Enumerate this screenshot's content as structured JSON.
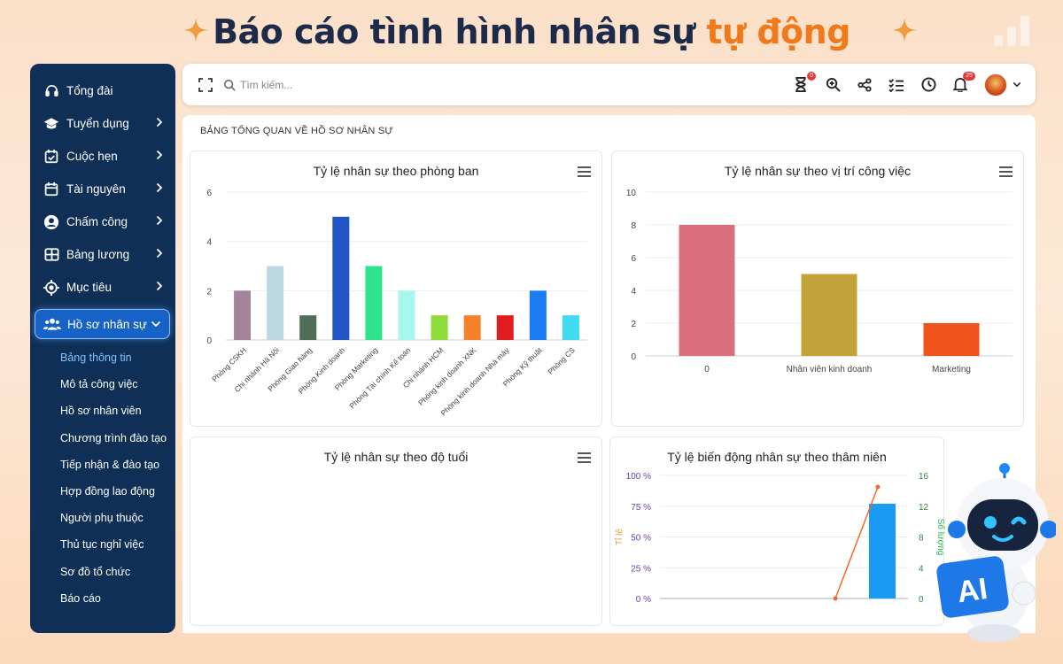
{
  "banner": {
    "title_main": "Báo cáo tình hình nhân sự ",
    "title_highlight": "tự động"
  },
  "sidebar": {
    "items": [
      {
        "label": "Tổng đài",
        "icon": "headset-icon",
        "chevron": false
      },
      {
        "label": "Tuyển dụng",
        "icon": "graduation-cap-icon",
        "chevron": true
      },
      {
        "label": "Cuộc hẹn",
        "icon": "calendar-check-icon",
        "chevron": true
      },
      {
        "label": "Tài nguyên",
        "icon": "calendar-icon",
        "chevron": true
      },
      {
        "label": "Chấm công",
        "icon": "user-circle-icon",
        "chevron": true
      },
      {
        "label": "Bảng lương",
        "icon": "table-icon",
        "chevron": true
      },
      {
        "label": "Mục tiêu",
        "icon": "target-icon",
        "chevron": true
      },
      {
        "label": "Hồ sơ nhân sự",
        "icon": "users-icon",
        "chevron": true,
        "active": true
      }
    ],
    "subitems": [
      "Bảng thông tin",
      "Mô tả công việc",
      "Hồ sơ nhân viên",
      "Chương trình đào tạo",
      "Tiếp nhận & đào tạo",
      "Hợp đồng lao động",
      "Người phụ thuộc",
      "Thủ tục nghỉ việc",
      "Sơ đồ tổ chức",
      "Báo cáo"
    ],
    "current_subitem": "Bảng thông tin"
  },
  "topbar": {
    "search_placeholder": "Tìm kiếm...",
    "timer_badge": "0",
    "notification_badge": "25"
  },
  "content": {
    "title": "BẢNG TỔNG QUAN VỀ HỒ SƠ NHÂN SỰ"
  },
  "chart_data": [
    {
      "type": "bar",
      "title": "Tỷ lệ nhân sự theo phòng ban",
      "categories": [
        "Phòng CSKH",
        "Chi nhánh Hà Nội",
        "Phòng Giao hàng",
        "Phòng Kinh doanh",
        "Phòng Marketing",
        "Phòng Tài chính Kế toán",
        "Chi nhánh HCM",
        "Phòng kinh doanh XNK",
        "Phòng kinh doanh Nhà máy",
        "Phòng Kỹ thuật",
        "Phòng CS"
      ],
      "values": [
        2,
        3,
        1,
        5,
        3,
        2,
        1,
        1,
        1,
        2,
        1
      ],
      "colors": [
        "#a3849b",
        "#bcd9e3",
        "#4e6e58",
        "#1f56c4",
        "#2fe38c",
        "#a8f7ee",
        "#8fdb3a",
        "#f5822a",
        "#e11d20",
        "#1b7bf2",
        "#40dbf0"
      ],
      "ylim": [
        0,
        6
      ],
      "yticks": [
        0,
        2,
        4,
        6
      ],
      "grid": true
    },
    {
      "type": "bar",
      "title": "Tỷ lệ nhân sự theo vị trí công việc",
      "categories": [
        "0",
        "Nhân viên kinh doanh",
        "Marketing"
      ],
      "values": [
        8,
        5,
        2
      ],
      "colors": [
        "#d96f7d",
        "#c4a23a",
        "#f0531a"
      ],
      "ylim": [
        0,
        10
      ],
      "yticks": [
        0,
        2,
        4,
        6,
        8,
        10
      ],
      "grid": true
    },
    {
      "type": "bar",
      "title": "Tỷ lệ nhân sự theo độ tuổi",
      "categories": [],
      "values": []
    },
    {
      "type": "bar",
      "title": "Tỷ lệ biến động nhân sự theo thâm niên",
      "ylabel": "Tỉ lệ",
      "y2label": "Số lượng",
      "yticks_left": [
        "0 %",
        "25 %",
        "50 %",
        "75 %",
        "100 %"
      ],
      "yticks_right": [
        0,
        4,
        8,
        12,
        16
      ],
      "ylim_left": [
        0,
        100
      ],
      "ylim_right": [
        0,
        16
      ],
      "bar_series": {
        "values": [
          77
        ],
        "color": "#1a9cf5"
      },
      "line_series": {
        "points": [
          [
            0,
            0
          ],
          [
            1,
            14.5
          ]
        ],
        "color": "#f5672a"
      },
      "grid": true
    }
  ],
  "colors": {
    "sidebar": "#0f2f56",
    "accent": "#1662c7",
    "highlight": "#f07a1a",
    "banner_text": "#1d2a4a"
  }
}
